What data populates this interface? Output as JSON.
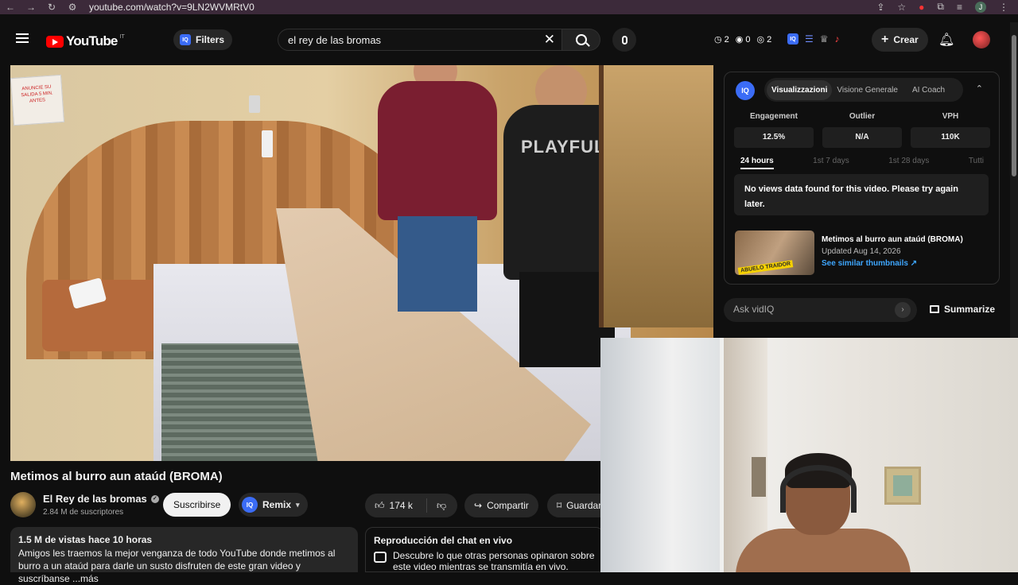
{
  "browser": {
    "url": "youtube.com/watch?v=9LN2WVMRtV0",
    "profile_initial": "J"
  },
  "header": {
    "logo_text": "YouTube",
    "logo_region": "IT",
    "filters_label": "Filters",
    "search_value": "el rey de las bromas",
    "stats": [
      "2",
      "0",
      "2"
    ],
    "create_label": "Crear"
  },
  "video": {
    "title": "Metimos al burro aun ataúd (BROMA)",
    "shirt_print": "PLAYFUL",
    "sign_text": "ANUNCIE SU SALIDA 5 MIN. ANTES"
  },
  "channel": {
    "name": "El Rey de las bromas",
    "subscribers": "2.84 M de suscriptores",
    "subscribe_label": "Suscribirse",
    "remix_label": "Remix"
  },
  "actions": {
    "likes": "174 k",
    "share_label": "Compartir",
    "save_label": "Guardar"
  },
  "description": {
    "meta": "1.5 M de vistas  hace 10 horas",
    "text": "Amigos les traemos la mejor venganza de todo YouTube donde metimos al burro a un ataúd para darle un susto disfruten de este gran video y suscríbanse ...más"
  },
  "chat": {
    "title": "Reproducción del chat en vivo",
    "text": "Descubre lo que otras personas opinaron sobre este video mientras se transmitía en vivo."
  },
  "vidiq": {
    "logo": "IQ",
    "tabs": [
      "Visualizzazioni",
      "Visione Generale",
      "AI Coach"
    ],
    "metrics": [
      {
        "label": "Engagement",
        "value": "12.5%"
      },
      {
        "label": "Outlier",
        "value": "N/A"
      },
      {
        "label": "VPH",
        "value": "110K"
      }
    ],
    "ranges": [
      "24 hours",
      "1st 7 days",
      "1st 28 days",
      "Tutti"
    ],
    "no_data": "No views data found for this video. Please try again later.",
    "thumb_title": "Metimos al burro aun ataúd (BROMA)",
    "thumb_updated": "Updated Aug 14, 2026",
    "thumb_link": "See similar thumbnails ↗",
    "thumb_tag": "ABUELO TRAIDOR",
    "ask_placeholder": "Ask vidIQ",
    "summarize_label": "Summarize"
  },
  "colors": {
    "accent_blue": "#3b6cf6",
    "link_blue": "#3ea6ff",
    "brand_red": "#ff0000"
  }
}
